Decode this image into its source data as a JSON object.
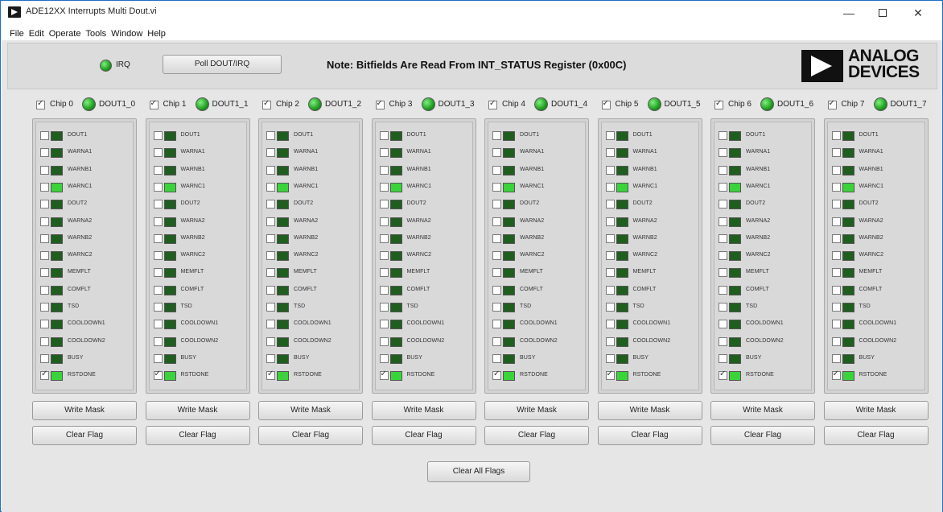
{
  "window": {
    "title": "ADE12XX Interrupts Multi Dout.vi",
    "minimize": "—",
    "close": "✕"
  },
  "menu": [
    "File",
    "Edit",
    "Operate",
    "Tools",
    "Window",
    "Help"
  ],
  "header": {
    "irq_label": "IRQ",
    "irq_led_on": true,
    "poll_button": "Poll DOUT/IRQ",
    "note": "Note: Bitfields Are Read From INT_STATUS Register (0x00C)",
    "logo_line1": "ANALOG",
    "logo_line2": "DEVICES"
  },
  "bit_names": [
    "DOUT1",
    "WARNA1",
    "WARNB1",
    "WARNC1",
    "DOUT2",
    "WARNA2",
    "WARNB2",
    "WARNC2",
    "MEMFLT",
    "COMFLT",
    "TSD",
    "COOLDOWN1",
    "COOLDOWN2",
    "BUSY",
    "RSTDONE"
  ],
  "lit_bits": [
    "WARNC1",
    "RSTDONE"
  ],
  "checked_bits": [
    "RSTDONE"
  ],
  "chips": [
    {
      "label": "Chip 0",
      "dout": "DOUT1_0",
      "enabled": true,
      "write_mask": "Write Mask",
      "clear_flag": "Clear Flag"
    },
    {
      "label": "Chip 1",
      "dout": "DOUT1_1",
      "enabled": true,
      "write_mask": "Write Mask",
      "clear_flag": "Clear Flag"
    },
    {
      "label": "Chip 2",
      "dout": "DOUT1_2",
      "enabled": true,
      "write_mask": "Write Mask",
      "clear_flag": "Clear Flag"
    },
    {
      "label": "Chip 3",
      "dout": "DOUT1_3",
      "enabled": true,
      "write_mask": "Write Mask",
      "clear_flag": "Clear Flag"
    },
    {
      "label": "Chip 4",
      "dout": "DOUT1_4",
      "enabled": true,
      "write_mask": "Write Mask",
      "clear_flag": "Clear Flag"
    },
    {
      "label": "Chip 5",
      "dout": "DOUT1_5",
      "enabled": true,
      "write_mask": "Write Mask",
      "clear_flag": "Clear Flag"
    },
    {
      "label": "Chip 6",
      "dout": "DOUT1_6",
      "enabled": true,
      "write_mask": "Write Mask",
      "clear_flag": "Clear Flag"
    },
    {
      "label": "Chip 7",
      "dout": "DOUT1_7",
      "enabled": true,
      "write_mask": "Write Mask",
      "clear_flag": "Clear Flag"
    }
  ],
  "footer": {
    "clear_all": "Clear All Flags"
  },
  "colors": {
    "led_on": "#3ad43a",
    "led_off": "#1f5e1f",
    "window_border": "#1e6fc4"
  }
}
